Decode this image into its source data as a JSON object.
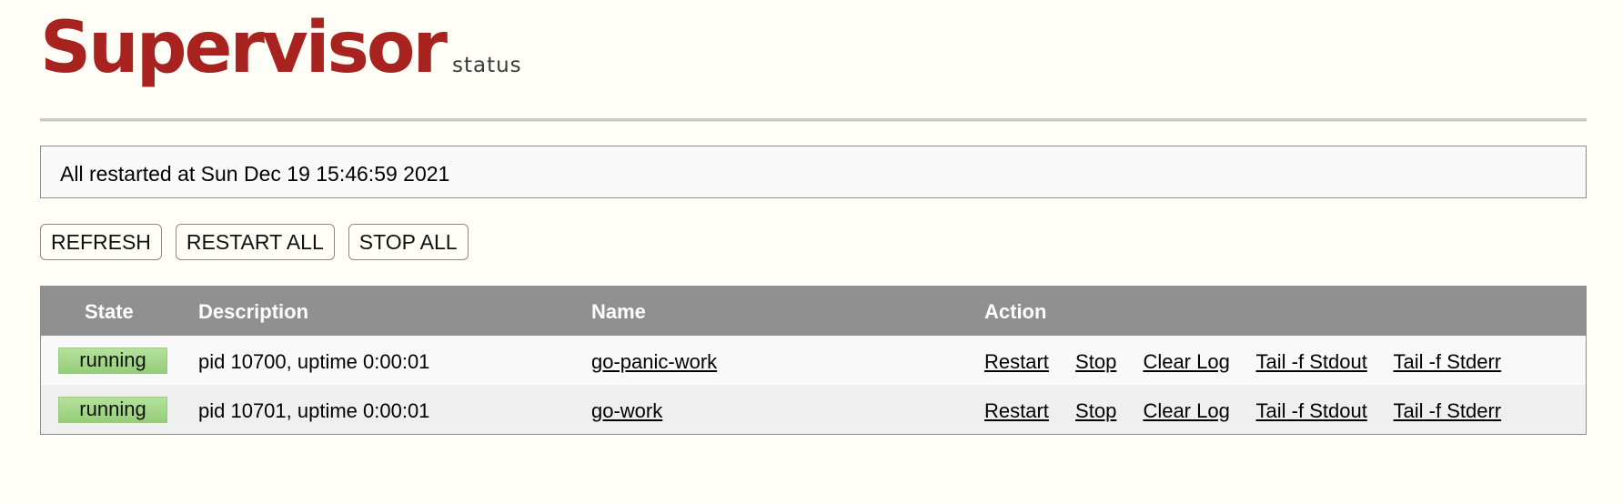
{
  "header": {
    "title": "Supervisor",
    "subtitle": "status"
  },
  "message": "All restarted at Sun Dec 19 15:46:59 2021",
  "buttons": {
    "refresh": "REFRESH",
    "restart_all": "RESTART ALL",
    "stop_all": "STOP ALL"
  },
  "table": {
    "columns": [
      "State",
      "Description",
      "Name",
      "Action"
    ],
    "rows": [
      {
        "state": "running",
        "description": "pid 10700, uptime 0:00:01",
        "name": "go-panic-work",
        "actions": [
          "Restart",
          "Stop",
          "Clear Log",
          "Tail -f Stdout",
          "Tail -f Stderr"
        ]
      },
      {
        "state": "running",
        "description": "pid 10701, uptime 0:00:01",
        "name": "go-work",
        "actions": [
          "Restart",
          "Stop",
          "Clear Log",
          "Tail -f Stdout",
          "Tail -f Stderr"
        ]
      }
    ]
  },
  "colors": {
    "logo": "#a8231f",
    "header_bg": "#909090",
    "running": "#a4d98a",
    "page_bg": "#fffff7"
  }
}
